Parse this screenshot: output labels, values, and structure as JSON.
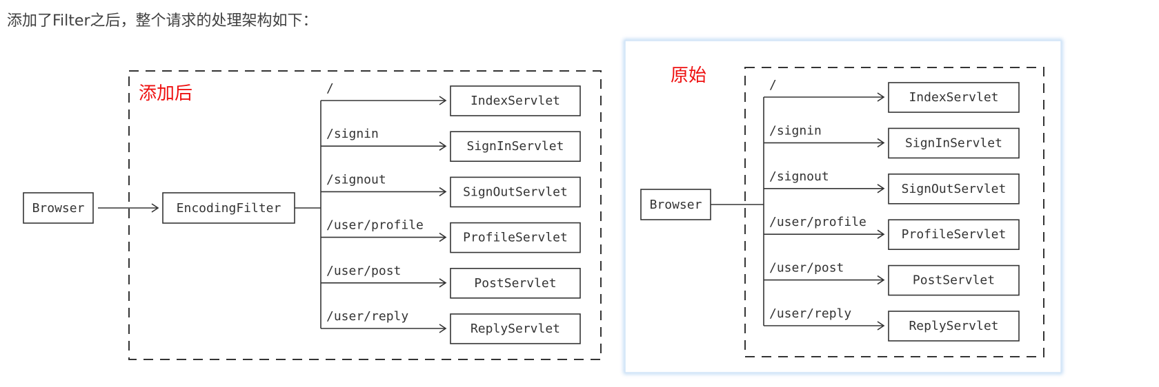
{
  "intro_text": "添加了Filter之后，整个请求的处理架构如下：",
  "left_diagram": {
    "label": "添加后",
    "browser": "Browser",
    "filter": "EncodingFilter",
    "routes": [
      {
        "path": "/",
        "servlet": "IndexServlet"
      },
      {
        "path": "/signin",
        "servlet": "SignInServlet"
      },
      {
        "path": "/signout",
        "servlet": "SignOutServlet"
      },
      {
        "path": "/user/profile",
        "servlet": "ProfileServlet"
      },
      {
        "path": "/user/post",
        "servlet": "PostServlet"
      },
      {
        "path": "/user/reply",
        "servlet": "ReplyServlet"
      }
    ]
  },
  "right_diagram": {
    "label": "原始",
    "browser": "Browser",
    "routes": [
      {
        "path": "/",
        "servlet": "IndexServlet"
      },
      {
        "path": "/signin",
        "servlet": "SignInServlet"
      },
      {
        "path": "/signout",
        "servlet": "SignOutServlet"
      },
      {
        "path": "/user/profile",
        "servlet": "ProfileServlet"
      },
      {
        "path": "/user/post",
        "servlet": "PostServlet"
      },
      {
        "path": "/user/reply",
        "servlet": "ReplyServlet"
      }
    ]
  },
  "colors": {
    "label_red": "#ee1111",
    "line": "#333333",
    "highlight_border": "#c4dcf5"
  }
}
